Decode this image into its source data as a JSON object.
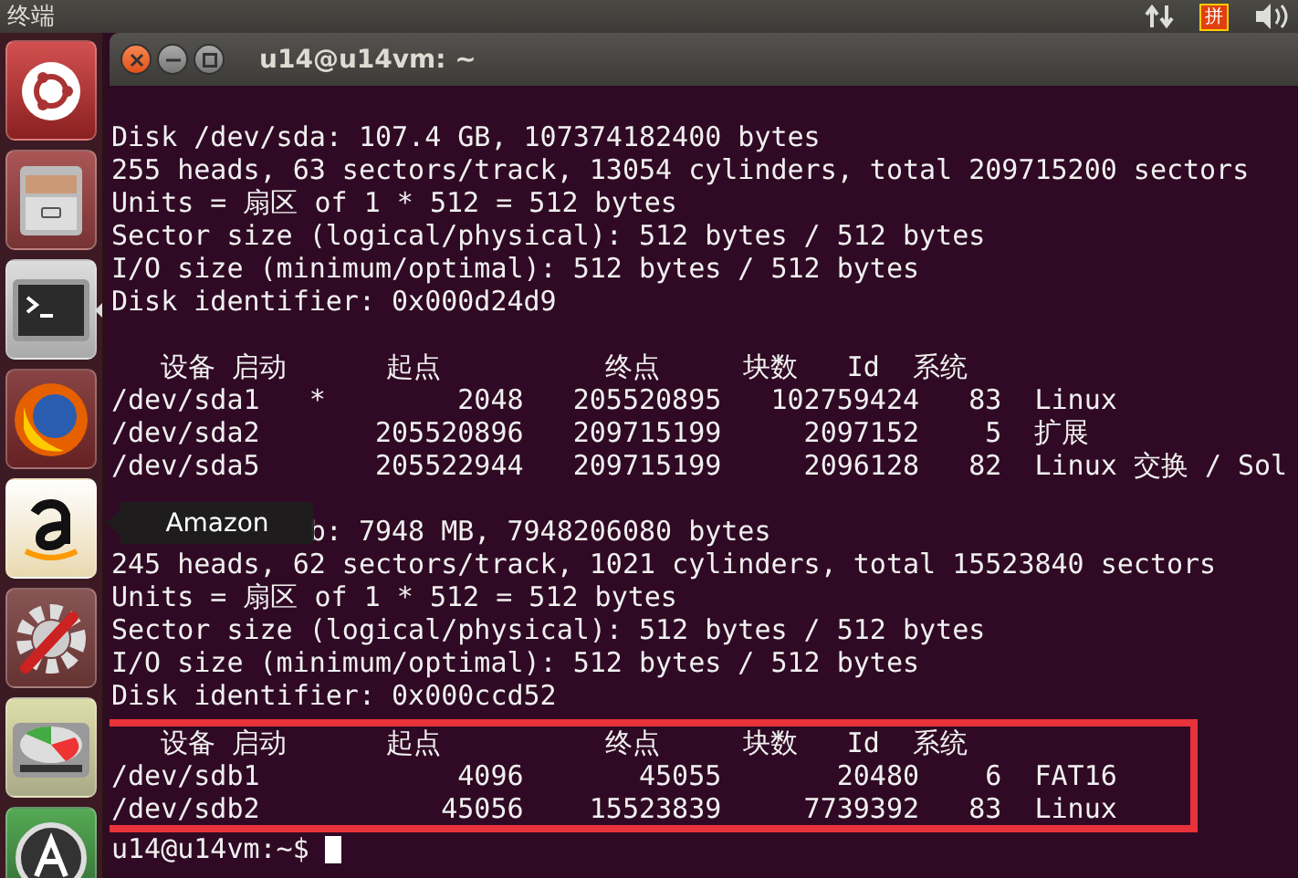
{
  "top_panel": {
    "app_title": "终端",
    "input_method": "拼"
  },
  "launcher": {
    "items": [
      {
        "kind": "dash",
        "active": false
      },
      {
        "kind": "files",
        "active": false
      },
      {
        "kind": "terminal",
        "active": true
      },
      {
        "kind": "browser",
        "active": false
      },
      {
        "kind": "amazon",
        "active": false
      },
      {
        "kind": "settings",
        "active": false
      },
      {
        "kind": "disk",
        "active": false
      },
      {
        "kind": "updater",
        "active": false
      }
    ],
    "tooltip": "Amazon"
  },
  "terminal": {
    "title": "u14@u14vm: ~",
    "blocks": [
      {
        "highlighted": false,
        "lines": [
          "Disk /dev/sda: 107.4 GB, 107374182400 bytes",
          "255 heads, 63 sectors/track, 13054 cylinders, total 209715200 sectors",
          "Units = 扇区 of 1 * 512 = 512 bytes",
          "Sector size (logical/physical): 512 bytes / 512 bytes",
          "I/O size (minimum/optimal): 512 bytes / 512 bytes",
          "Disk identifier: 0x000d24d9"
        ]
      },
      {
        "highlighted": false,
        "lines": [
          "   设备 启动      起点          终点     块数   Id  系统",
          "/dev/sda1   *        2048   205520895   102759424   83  Linux",
          "/dev/sda2       205520896   209715199     2097152    5  扩展",
          "/dev/sda5       205522944   209715199     2096128   82  Linux 交换 / Sol"
        ]
      },
      {
        "highlighted": false,
        "covered_start": true,
        "lines": [
          "b: 7948 MB, 7948206080 bytes",
          "245 heads, 62 sectors/track, 1021 cylinders, total 15523840 sectors",
          "Units = 扇区 of 1 * 512 = 512 bytes",
          "Sector size (logical/physical): 512 bytes / 512 bytes",
          "I/O size (minimum/optimal): 512 bytes / 512 bytes",
          "Disk identifier: 0x000ccd52"
        ]
      },
      {
        "highlighted": true,
        "lines": [
          "   设备 启动      起点          终点     块数   Id  系统",
          "/dev/sdb1            4096       45055       20480    6  FAT16",
          "/dev/sdb2           45056    15523839     7739392   83  Linux"
        ]
      }
    ],
    "prompt": "u14@u14vm:~$ "
  }
}
